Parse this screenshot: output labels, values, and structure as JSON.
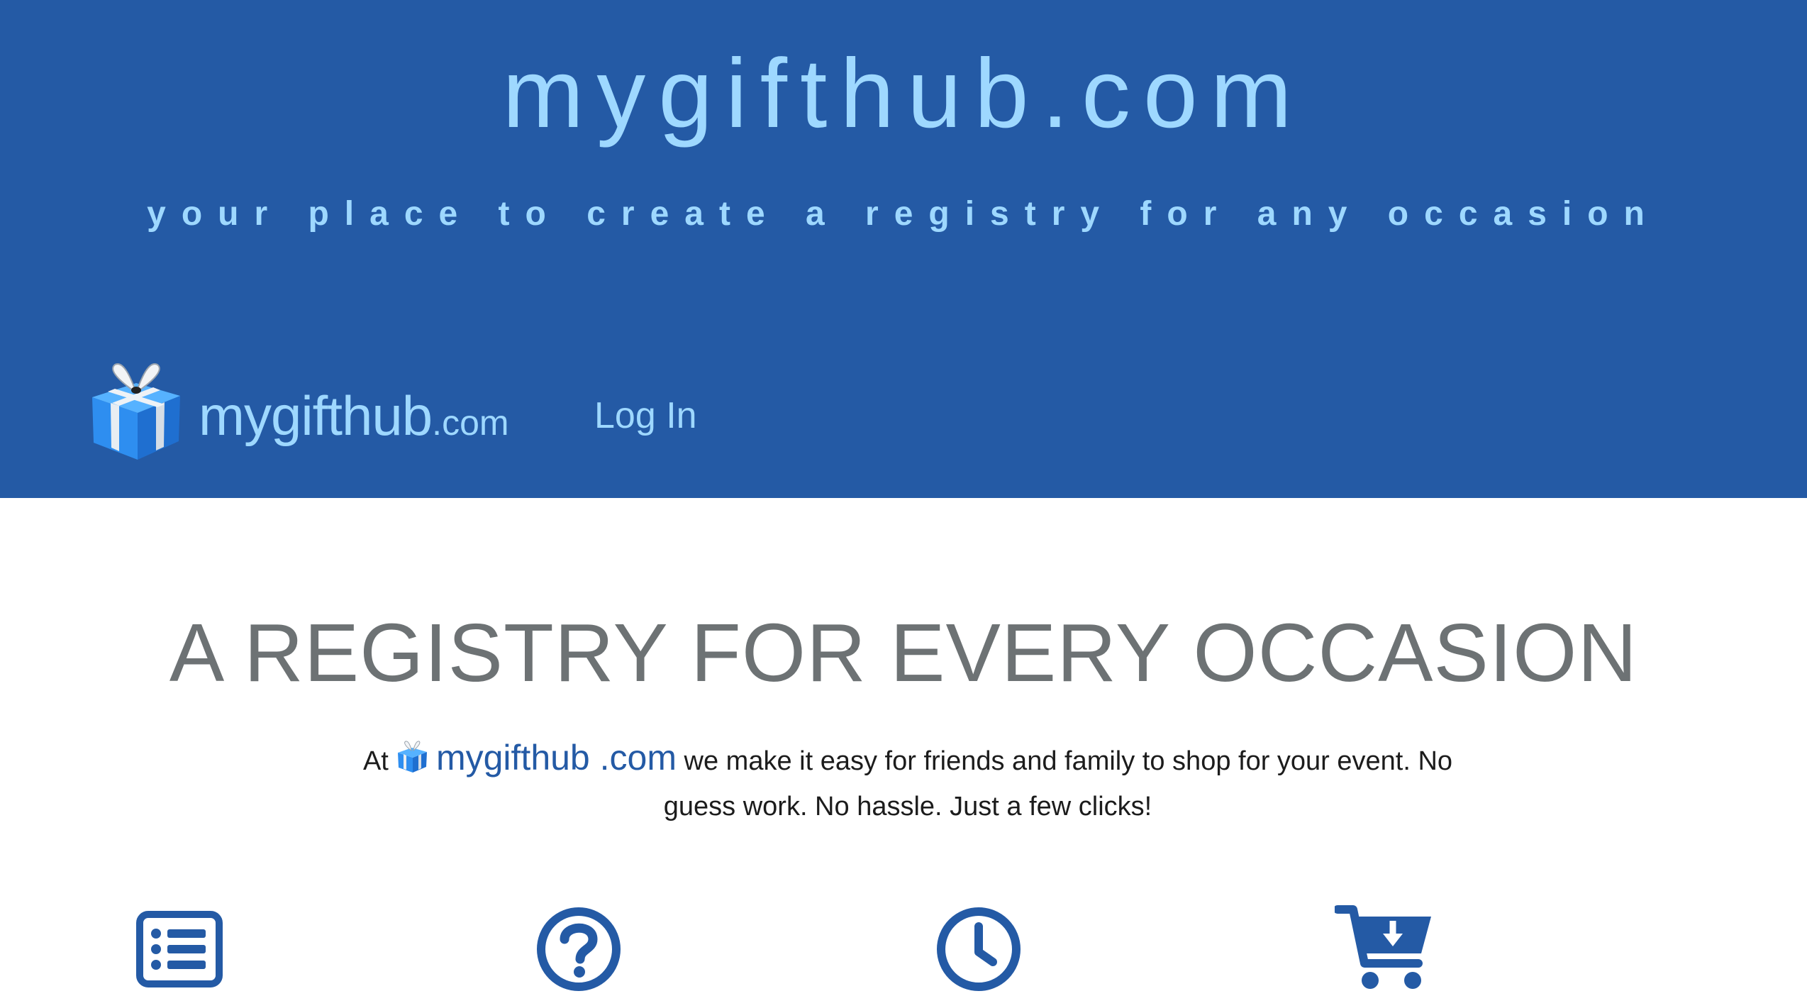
{
  "header": {
    "title": "mygifthub.com",
    "tagline": "your place to create a registry for any occasion"
  },
  "navbar": {
    "brand_name": "mygifthub",
    "brand_tld": ".com",
    "login_label": "Log In"
  },
  "main": {
    "section_title": "A REGISTRY FOR EVERY OCCASION",
    "intro_prefix": "At",
    "intro_brand": "mygifthub .com",
    "intro_text": "we make it easy for friends and family to shop for your event. No guess work. No hassle. Just a few clicks!",
    "features": [
      {
        "icon": "list-icon"
      },
      {
        "icon": "question-circle-icon"
      },
      {
        "icon": "clock-icon"
      },
      {
        "icon": "cart-download-icon"
      }
    ]
  },
  "colors": {
    "header_bg": "#245aa5",
    "header_text": "#9ed8ff",
    "title_gray": "#6d7274",
    "accent_blue": "#245aa5"
  }
}
